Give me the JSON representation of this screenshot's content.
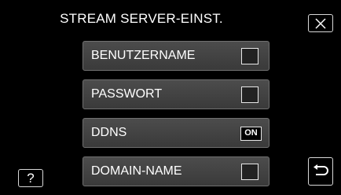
{
  "header": {
    "title": "STREAM SERVER-EINST."
  },
  "buttons": {
    "help_label": "?"
  },
  "icons": {
    "close": "close-icon",
    "back": "back-return-icon"
  },
  "menu": {
    "items": [
      {
        "label": "BENUTZERNAME",
        "control": "checkbox",
        "checked": false
      },
      {
        "label": "PASSWORT",
        "control": "checkbox",
        "checked": false
      },
      {
        "label": "DDNS",
        "control": "toggle",
        "value": "ON"
      },
      {
        "label": "DOMAIN-NAME",
        "control": "checkbox",
        "checked": false
      }
    ]
  }
}
